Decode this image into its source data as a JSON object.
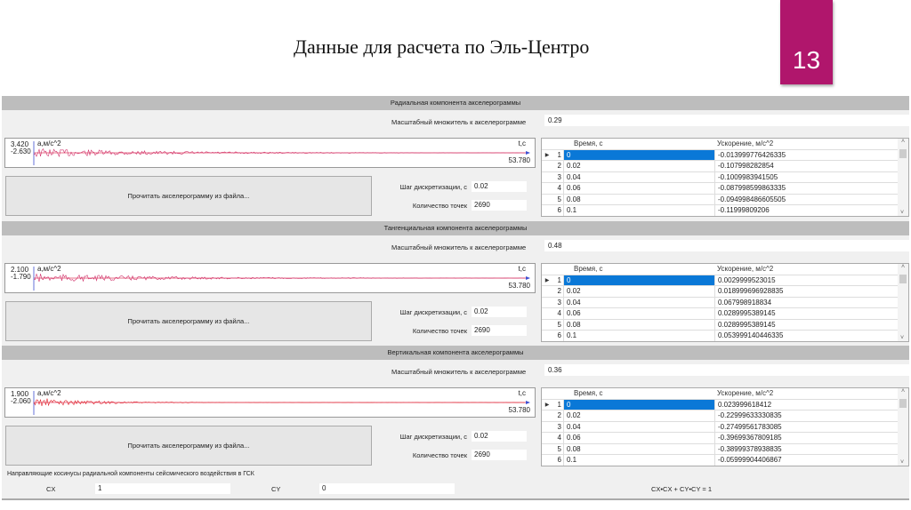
{
  "slide": {
    "title": "Данные для расчета по Эль-Центро",
    "page_number": "13",
    "accent_color": "#b0166c"
  },
  "common": {
    "scale_label": "Масштабный множитель к акселерограмме",
    "read_button": "Прочитать акселерограмму из файла...",
    "step_label": "Шаг дискретизации, с",
    "count_label": "Количество точек",
    "y_axis_label": "a,м/с^2",
    "x_axis_label": "t,c",
    "col_time": "Время, с",
    "col_accel": "Ускорение, м/с^2"
  },
  "sections": [
    {
      "title": "Радиальная компонента акселерограммы",
      "scale": "0.29",
      "ymax": "3.420",
      "ymin": "-2.630",
      "xmax": "53.780",
      "step": "0.02",
      "count": "2690",
      "rows": [
        [
          "1",
          "0",
          "-0.013999776426335"
        ],
        [
          "2",
          "0.02",
          "-0.107998282854"
        ],
        [
          "3",
          "0.04",
          "-0.1009983941505"
        ],
        [
          "4",
          "0.06",
          "-0.087998599863335"
        ],
        [
          "5",
          "0.08",
          "-0.094998486605505"
        ],
        [
          "6",
          "0.1",
          "-0.11999809206"
        ]
      ]
    },
    {
      "title": "Тангенциальная компонента акселерограммы",
      "scale": "0.48",
      "ymax": "2.100",
      "ymin": "-1.790",
      "xmax": "53.780",
      "step": "0.02",
      "count": "2690",
      "rows": [
        [
          "1",
          "0",
          "0.0029999523015"
        ],
        [
          "2",
          "0.02",
          "0.018999696928835"
        ],
        [
          "3",
          "0.04",
          "0.067998918834"
        ],
        [
          "4",
          "0.06",
          "0.0289995389145"
        ],
        [
          "5",
          "0.08",
          "0.0289995389145"
        ],
        [
          "6",
          "0.1",
          "0.053999140446335"
        ]
      ]
    },
    {
      "title": "Вертикальная компонента акселерограммы",
      "scale": "0.36",
      "ymax": "1.900",
      "ymin": "-2.060",
      "xmax": "53.780",
      "step": "0.02",
      "count": "2690",
      "rows": [
        [
          "1",
          "0",
          "0.023999618412"
        ],
        [
          "2",
          "0.02",
          "-0.22999633330835"
        ],
        [
          "3",
          "0.04",
          "-0.27499561783085"
        ],
        [
          "4",
          "0.06",
          "-0.39699367809185"
        ],
        [
          "5",
          "0.08",
          "-0.38999378938835"
        ],
        [
          "6",
          "0.1",
          "-0.05999904406867"
        ]
      ]
    }
  ],
  "cosines": {
    "title": "Направляющие косинусы радиальной компоненты сейсмического воздействия в ГСК",
    "cx_label": "CX",
    "cx_value": "1",
    "cy_label": "CY",
    "cy_value": "0",
    "formula": "CX•CX + CY•CY = 1"
  }
}
